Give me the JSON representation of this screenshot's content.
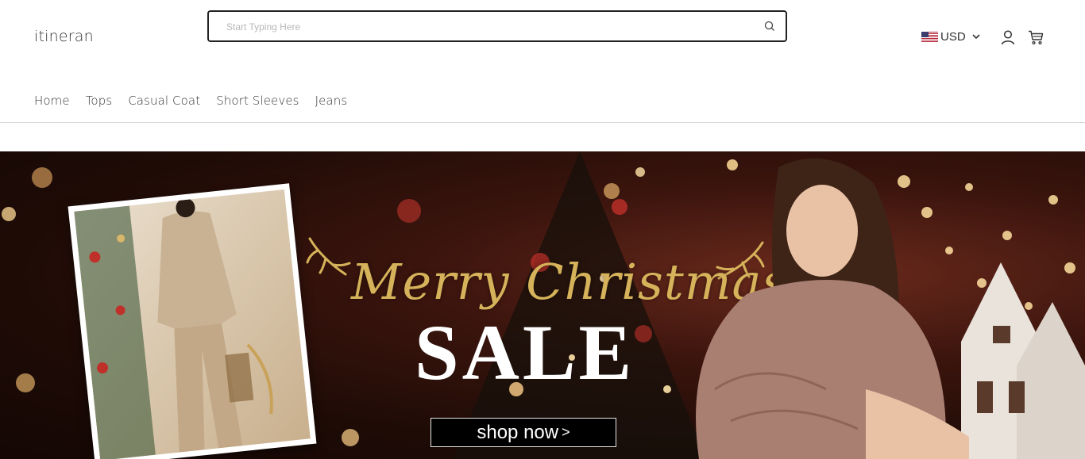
{
  "header": {
    "logo_text": "itineran",
    "search": {
      "placeholder": "Start Typing Here",
      "value": ""
    },
    "currency": {
      "code": "USD",
      "flag_icon": "us-flag-icon"
    },
    "icons": {
      "account": "user-icon",
      "cart": "cart-icon",
      "search": "search-icon"
    }
  },
  "nav": {
    "items": [
      {
        "label": "Home"
      },
      {
        "label": "Tops"
      },
      {
        "label": "Casual Coat"
      },
      {
        "label": "Short Sleeves"
      },
      {
        "label": "Jeans"
      }
    ]
  },
  "banner": {
    "headline": "Merry Christmas",
    "subheadline": "SALE",
    "cta_label": "shop now",
    "cta_arrow": ">",
    "colors": {
      "gold": "#d6b35a",
      "dark": "#1e0b06",
      "button": "#000000"
    }
  }
}
